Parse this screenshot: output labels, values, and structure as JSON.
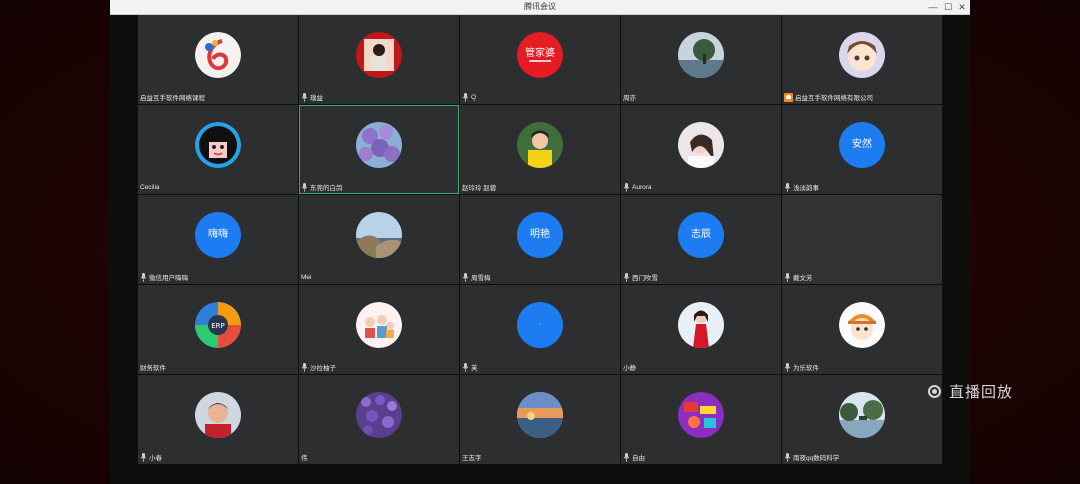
{
  "window": {
    "title": "腾讯会议"
  },
  "titlebar_buttons": {
    "minimize": "—",
    "maximize": "☐",
    "close": "✕"
  },
  "overlay": {
    "live_replay_label": "直播回放"
  },
  "participants": [
    {
      "name": "启益互手软件网络课程",
      "avatar": "logo-six-icon",
      "mic": false
    },
    {
      "name": "璞益",
      "avatar": "photo-person-red",
      "mic": true
    },
    {
      "name": "Q",
      "avatar": "logo-guanjiapo",
      "mic": true
    },
    {
      "name": "周亦",
      "avatar": "photo-tree-landscape",
      "mic": false
    },
    {
      "name": "启益互手软件网络有限公司",
      "avatar": "cartoon-girl",
      "mic": false,
      "host": true
    },
    {
      "name": "Cecilia",
      "avatar": "cartoon-dark-hair",
      "mic": false
    },
    {
      "name": "东莞的白鸽",
      "avatar": "photo-purple-flowers",
      "mic": true,
      "active": true
    },
    {
      "name": "赵玲玲 赵蓉",
      "avatar": "photo-woman-yellow",
      "mic": false
    },
    {
      "name": "Aurora",
      "avatar": "photo-woman-white",
      "mic": true
    },
    {
      "name": "浅淡韵事",
      "avatar": "text",
      "avatar_text": "安然",
      "mic": true
    },
    {
      "name": "微信用户嗨嗨",
      "avatar": "text",
      "avatar_text": "嗨嗨",
      "mic": true
    },
    {
      "name": "Mei",
      "avatar": "photo-coast",
      "mic": false
    },
    {
      "name": "周雪梅",
      "avatar": "text",
      "avatar_text": "明艳",
      "mic": true
    },
    {
      "name": "西门吹雪",
      "avatar": "text",
      "avatar_text": "志辰",
      "mic": true
    },
    {
      "name": "戴文芳",
      "avatar": "none",
      "mic": true
    },
    {
      "name": "财务软件",
      "avatar": "erp-wheel",
      "mic": false
    },
    {
      "name": "沙拉柚子",
      "avatar": "cartoon-family",
      "mic": true
    },
    {
      "name": "芙",
      "avatar": "text",
      "avatar_text": "·",
      "mic": true
    },
    {
      "name": "小静",
      "avatar": "photo-woman-red-dress",
      "mic": false
    },
    {
      "name": "为乐软件",
      "avatar": "cartoon-beanie-girl",
      "mic": true
    },
    {
      "name": "小春",
      "avatar": "photo-man-red",
      "mic": true
    },
    {
      "name": "伟",
      "avatar": "photo-lavender",
      "mic": false
    },
    {
      "name": "王志字",
      "avatar": "photo-sunset-sea",
      "mic": false
    },
    {
      "name": "自由",
      "avatar": "cartoon-colorful",
      "mic": true
    },
    {
      "name": "雨夜qq数码科学",
      "avatar": "photo-lakeside",
      "mic": true
    }
  ],
  "colors": {
    "tile_bg": "#2d2e30",
    "avatar_blue": "#1e7cf2",
    "active_border": "#3bb26b"
  }
}
